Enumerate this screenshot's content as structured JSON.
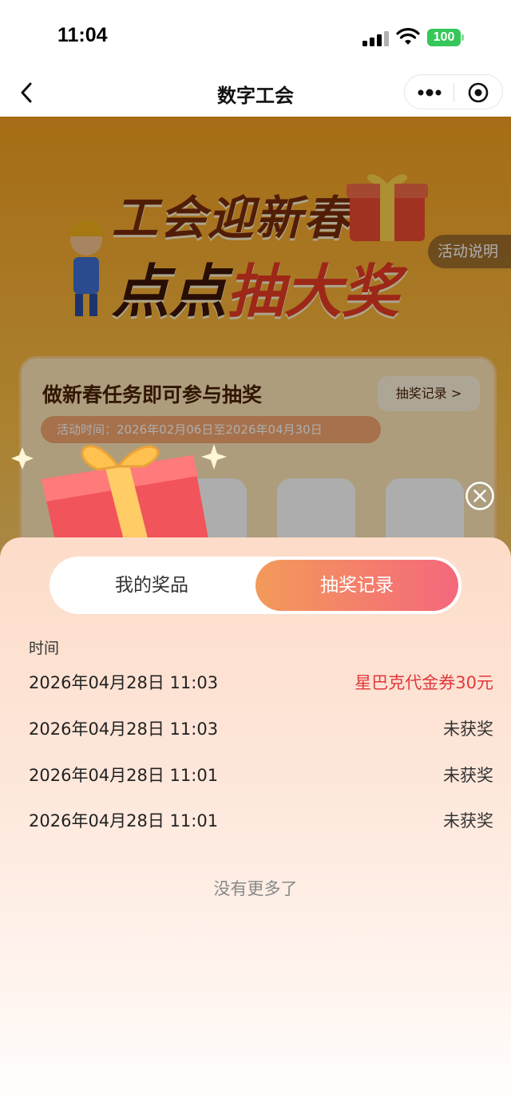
{
  "status_bar": {
    "time": "11:04",
    "battery": "100"
  },
  "nav": {
    "title": "数字工会"
  },
  "background": {
    "banner_line1": "工会迎新春",
    "banner_line2_a": "点点",
    "banner_line2_b": "抽大奖",
    "rules_label": "活动说明",
    "task_title": "做新春任务即可参与抽奖",
    "record_link": "抽奖记录 >",
    "date_range": "活动时间：2026年02月06日至2026年04月30日"
  },
  "sheet": {
    "tabs": {
      "prizes": "我的奖品",
      "records": "抽奖记录"
    },
    "column_header": "时间",
    "records": [
      {
        "time": "2026年04月28日 11:03",
        "result": "星巴克代金券30元"
      },
      {
        "time": "2026年04月28日 11:03",
        "result": "未获奖"
      },
      {
        "time": "2026年04月28日 11:01",
        "result": "未获奖"
      },
      {
        "time": "2026年04月28日 11:01",
        "result": "未获奖"
      }
    ],
    "no_more": "没有更多了"
  },
  "colors": {
    "accent_win": "#e2383b",
    "tab_gradient_start": "#f39a5a",
    "tab_gradient_end": "#f4687b"
  },
  "icons": [
    "back-icon",
    "more-icon",
    "mini-program-close-icon",
    "close-modal-icon",
    "gift-icon"
  ]
}
